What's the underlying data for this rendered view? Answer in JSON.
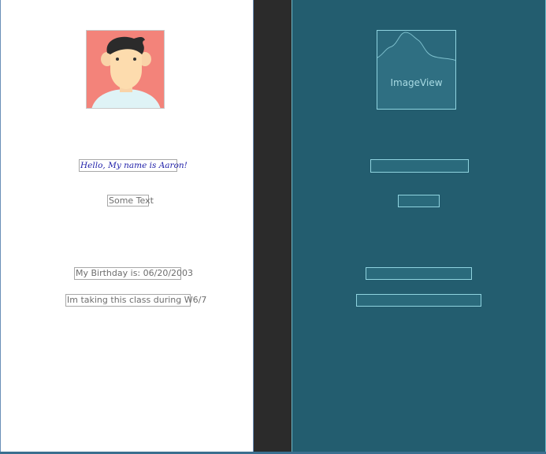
{
  "design": {
    "avatar_icon": "person-avatar-icon",
    "greeting_text": "Hello, My name is Aaron!",
    "some_text": "Some Text",
    "birthday_text": "My Birthday is: 06/20/2003",
    "class_text": "Im taking this class during W6/7"
  },
  "blueprint": {
    "image_view_label": "ImageView"
  },
  "colors": {
    "design_background": "#ffffff",
    "blueprint_background": "#235d6f",
    "avatar_background": "#f3837a",
    "greeting_color": "#1d1da8"
  }
}
